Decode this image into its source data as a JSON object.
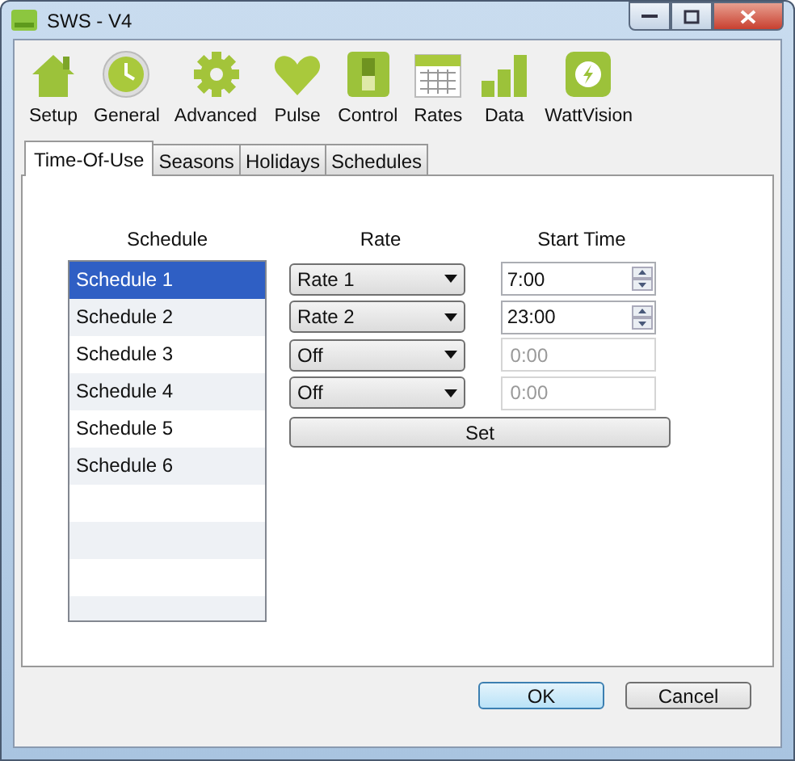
{
  "window": {
    "title": "SWS - V4"
  },
  "toolbar": [
    {
      "label": "Setup"
    },
    {
      "label": "General"
    },
    {
      "label": "Advanced"
    },
    {
      "label": "Pulse"
    },
    {
      "label": "Control"
    },
    {
      "label": "Rates"
    },
    {
      "label": "Data"
    },
    {
      "label": "WattVision"
    }
  ],
  "tabs": [
    {
      "label": "Time-Of-Use",
      "selected": true
    },
    {
      "label": "Seasons",
      "selected": false
    },
    {
      "label": "Holidays",
      "selected": false
    },
    {
      "label": "Schedules",
      "selected": false
    }
  ],
  "schedule_list": {
    "heading": "Schedule",
    "items": [
      {
        "label": "Schedule 1",
        "selected": true
      },
      {
        "label": "Schedule 2",
        "selected": false
      },
      {
        "label": "Schedule 3",
        "selected": false
      },
      {
        "label": "Schedule 4",
        "selected": false
      },
      {
        "label": "Schedule 5",
        "selected": false
      },
      {
        "label": "Schedule 6",
        "selected": false
      }
    ]
  },
  "rate_heading": "Rate",
  "start_time_heading": "Start Time",
  "periods": [
    {
      "rate": "Rate 1",
      "start_time": "7:00",
      "disabled": false
    },
    {
      "rate": "Rate 2",
      "start_time": "23:00",
      "disabled": false
    },
    {
      "rate": "Off",
      "start_time": "0:00",
      "disabled": true
    },
    {
      "rate": "Off",
      "start_time": "0:00",
      "disabled": true
    }
  ],
  "set_button": "Set",
  "buttons": [
    {
      "label": "OK",
      "kind": "default"
    },
    {
      "label": "Cancel",
      "kind": "normal"
    }
  ]
}
